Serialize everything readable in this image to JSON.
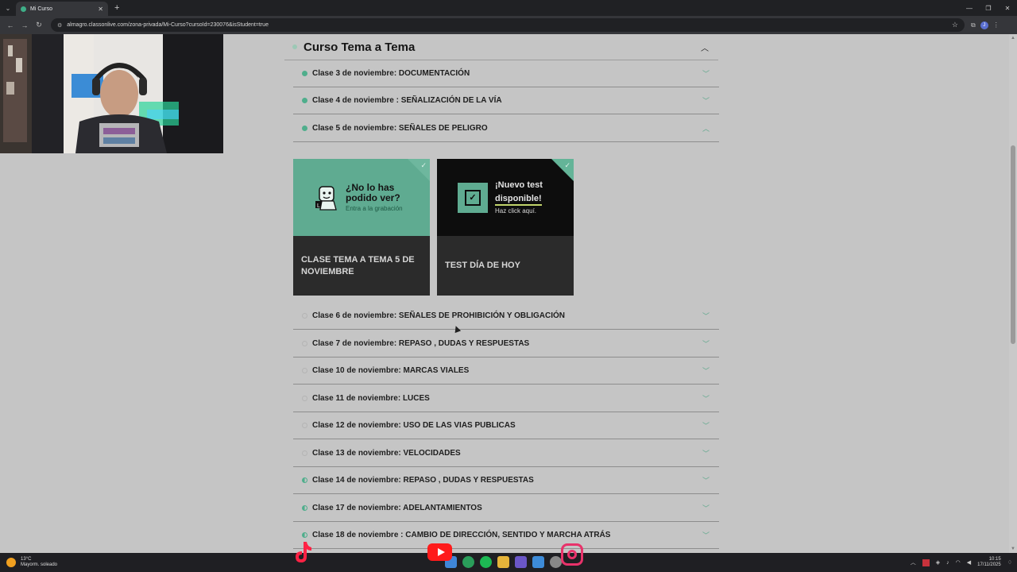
{
  "browser": {
    "tab_title": "Mi Curso",
    "url": "almagro.classonlive.com/zona-privada/Mi-Curso?cursoId=230076&isStudent=true",
    "new_tab": "+",
    "tab_close": "✕"
  },
  "course": {
    "section_title": "Curso Tema a Tema",
    "lessons_top": [
      {
        "label": "Clase 3 de noviembre: DOCUMENTACIÓN",
        "status": "done"
      },
      {
        "label": "Clase 4 de noviembre : SEÑALIZACIÓN DE LA VÍA",
        "status": "done"
      },
      {
        "label": "Clase 5 de noviembre: SEÑALES DE PELIGRO",
        "status": "done"
      }
    ],
    "cards": [
      {
        "promo_line1": "¿No lo has",
        "promo_line2": "podido ver?",
        "promo_sub": "Entra a la grabación",
        "title": "CLASE TEMA A TEMA 5 DE NOVIEMBRE"
      },
      {
        "promo_line1": "¡Nuevo test",
        "promo_line2": "disponible!",
        "promo_sub": "Haz click aquí.",
        "title": "TEST DÍA DE HOY"
      }
    ],
    "lessons_bottom": [
      {
        "label": "Clase 6 de noviembre: SEÑALES DE PROHIBICIÓN Y OBLIGACIÓN",
        "status": "empty"
      },
      {
        "label": "Clase 7 de noviembre: REPASO , DUDAS Y RESPUESTAS",
        "status": "empty"
      },
      {
        "label": "Clase 10 de noviembre: MARCAS VIALES",
        "status": "empty"
      },
      {
        "label": "Clase 11 de noviembre: LUCES",
        "status": "empty"
      },
      {
        "label": "Clase 12 de noviembre: USO DE LAS VIAS PUBLICAS",
        "status": "empty"
      },
      {
        "label": "Clase 13 de noviembre: VELOCIDADES",
        "status": "empty"
      },
      {
        "label": "Clase 14 de noviembre: REPASO , DUDAS Y RESPUESTAS",
        "status": "half"
      },
      {
        "label": "Clase 17 de noviembre: ADELANTAMIENTOS",
        "status": "half"
      },
      {
        "label": "Clase 18 de noviembre : CAMBIO DE DIRECCIÓN, SENTIDO Y MARCHA ATRÁS",
        "status": "half"
      }
    ]
  },
  "taskbar": {
    "weather_temp": "13°C",
    "weather_desc": "Mayorm. soleado",
    "time": "10:15",
    "date": "17/11/2025"
  },
  "colors": {
    "accent_green": "#5fab91",
    "card_dark": "#2b2b2b",
    "youtube_red": "#ff1b1b",
    "instagram_pink": "#e8326a"
  }
}
